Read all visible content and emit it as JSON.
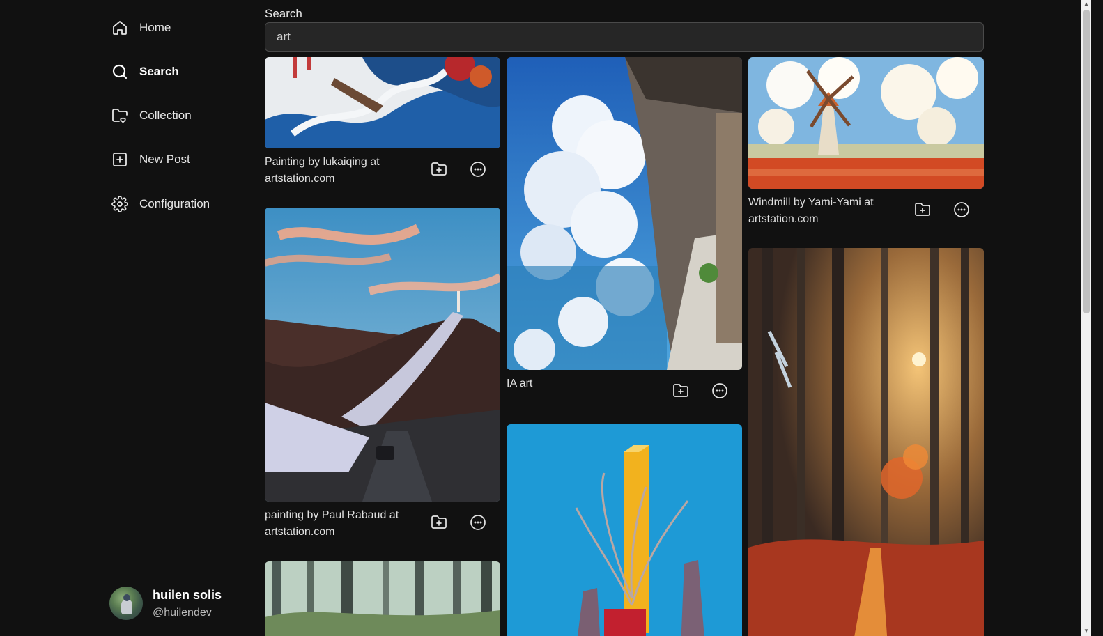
{
  "sidebar": {
    "items": [
      {
        "label": "Home",
        "icon": "home-icon"
      },
      {
        "label": "Search",
        "icon": "search-icon",
        "active": true
      },
      {
        "label": "Collection",
        "icon": "folder-heart-icon"
      },
      {
        "label": "New Post",
        "icon": "plus-square-icon"
      },
      {
        "label": "Configuration",
        "icon": "gear-icon"
      }
    ],
    "user": {
      "name": "huilen solis",
      "handle": "@huilendev"
    }
  },
  "search": {
    "label": "Search",
    "value": "art"
  },
  "posts": [
    {
      "caption": "Painting by lukaiqing at artstation.com"
    },
    {
      "caption": "painting by Paul Rabaud at artstation.com"
    },
    {
      "caption": "IA art"
    },
    {
      "caption": "Windmill by Yami-Yami at artstation.com"
    },
    {
      "caption": ""
    },
    {
      "caption": ""
    },
    {
      "caption": ""
    }
  ],
  "colors": {
    "background": "#111111",
    "input_bg": "#262626",
    "text": "#e6e6e6"
  }
}
